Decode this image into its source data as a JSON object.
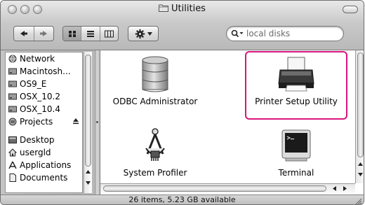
{
  "window": {
    "title": "Utilities"
  },
  "toolbar": {
    "back_icon": "back-arrow-icon",
    "forward_icon": "forward-arrow-icon",
    "view_modes": [
      "icon-view-icon",
      "list-view-icon",
      "column-view-icon"
    ],
    "action_icon": "gear-icon",
    "search_placeholder": "local disks"
  },
  "sidebar": {
    "devices": [
      {
        "label": "Network",
        "icon": "network-globe-icon"
      },
      {
        "label": "Macintosh...",
        "icon": "hard-disk-icon"
      },
      {
        "label": "OS9_E",
        "icon": "hard-disk-icon"
      },
      {
        "label": "OSX_10.2",
        "icon": "hard-disk-icon"
      },
      {
        "label": "OSX_10.4",
        "icon": "hard-disk-icon"
      },
      {
        "label": "Projects",
        "icon": "network-volume-icon",
        "eject": true
      }
    ],
    "places": [
      {
        "label": "Desktop",
        "icon": "desktop-icon"
      },
      {
        "label": "usergld",
        "icon": "home-icon"
      },
      {
        "label": "Applications",
        "icon": "applications-icon"
      },
      {
        "label": "Documents",
        "icon": "documents-icon"
      }
    ]
  },
  "items": [
    {
      "label": "ODBC Administrator",
      "icon": "database-icon"
    },
    {
      "label": "Printer Setup Utility",
      "icon": "printer-icon",
      "highlighted": true
    },
    {
      "label": "System Profiler",
      "icon": "system-profiler-icon"
    },
    {
      "label": "Terminal",
      "icon": "terminal-icon"
    }
  ],
  "status": {
    "text": "26 items, 5.23 GB available"
  },
  "colors": {
    "highlight": "#d8157e",
    "metal": "#c4c4c4"
  }
}
